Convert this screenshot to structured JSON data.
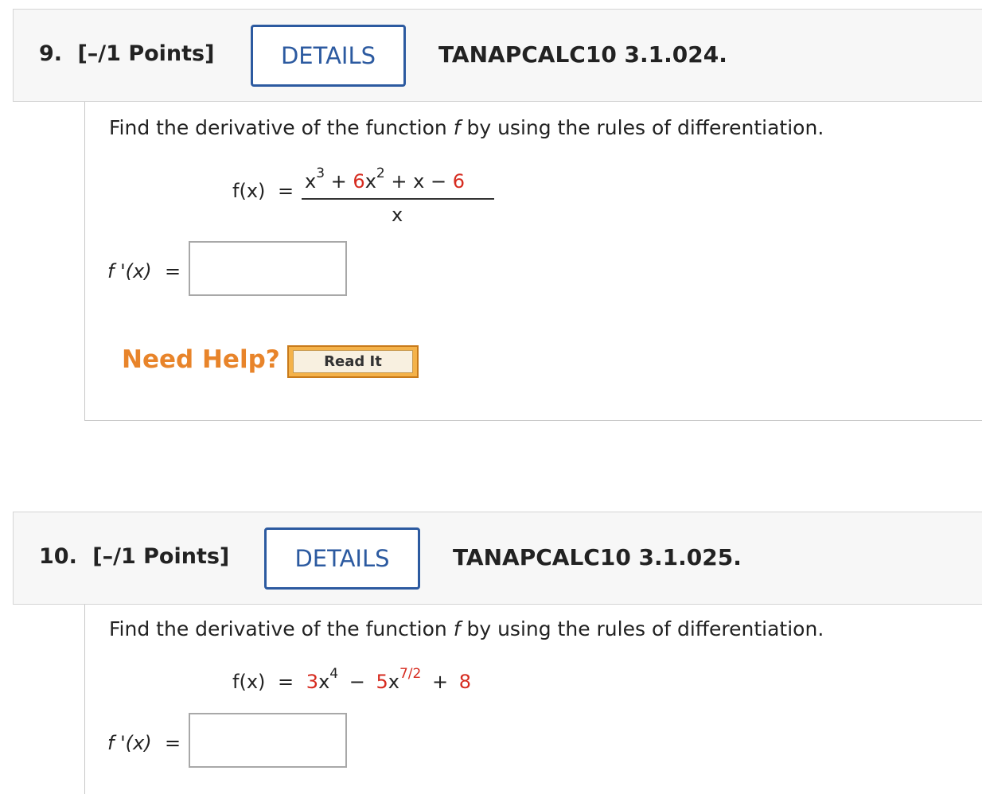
{
  "questions": [
    {
      "number": "9.",
      "points": "[–/1 Points]",
      "details_label": "DETAILS",
      "code": "TANAPCALC10 3.1.024.",
      "instruction_pre": "Find the derivative of the function ",
      "instruction_var": "f",
      "instruction_post": " by using the rules of differentiation.",
      "function_lhs": "f(x)",
      "equals": "=",
      "numerator": {
        "t1_base": "x",
        "t1_exp": "3",
        "op1": "+",
        "t2_coef": "6",
        "t2_base": "x",
        "t2_exp": "2",
        "op2": "+",
        "t3": "x",
        "op3": "−",
        "t4": "6"
      },
      "denominator": "x",
      "answer_label": "f '(x)",
      "answer_value": "",
      "need_help": "Need Help?",
      "read_it": "Read It"
    },
    {
      "number": "10.",
      "points": "[–/1 Points]",
      "details_label": "DETAILS",
      "code": "TANAPCALC10 3.1.025.",
      "instruction_pre": "Find the derivative of the function ",
      "instruction_var": "f",
      "instruction_post": " by using the rules of differentiation.",
      "function_lhs": "f(x)",
      "equals": "=",
      "rhs": {
        "t1_coef": "3",
        "t1_base": "x",
        "t1_exp": "4",
        "op1": "−",
        "t2_coef": "5",
        "t2_base": "x",
        "t2_exp": "7/2",
        "op2": "+",
        "t3": "8"
      },
      "answer_label": "f '(x)",
      "answer_value": ""
    }
  ],
  "colors": {
    "details_blue": "#2c5aa0",
    "red_param": "#d62b1f",
    "need_help_orange": "#e8842a",
    "read_it_gold": "#f4b24a"
  }
}
